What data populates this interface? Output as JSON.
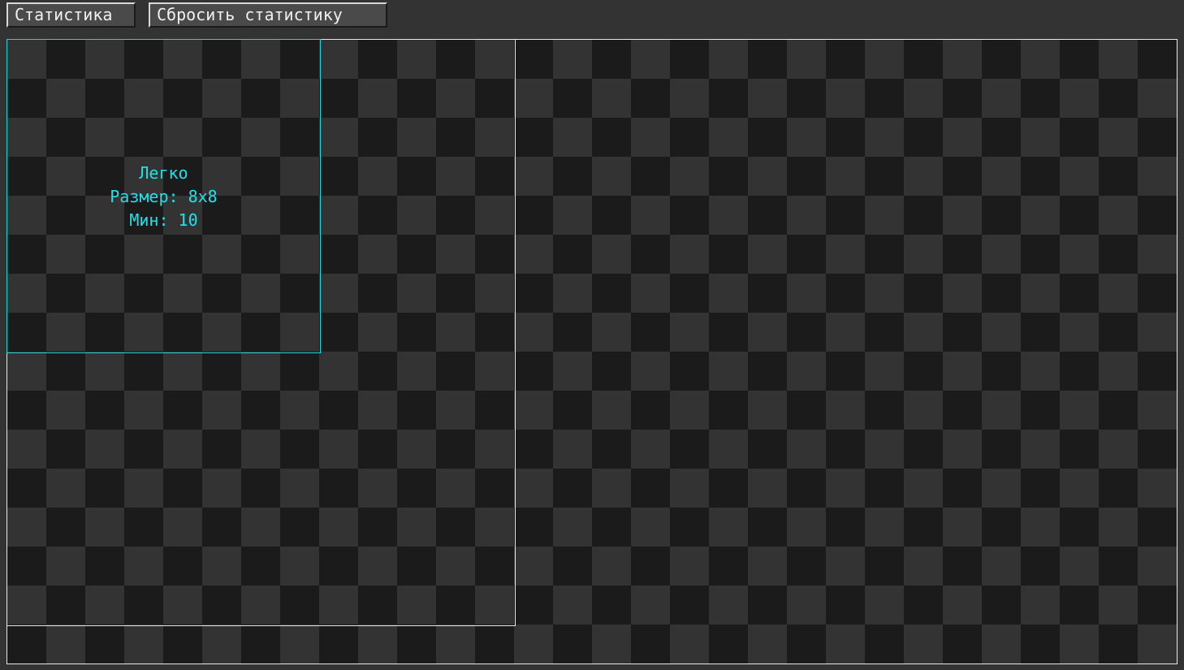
{
  "toolbar": {
    "stats_label": "Статистика",
    "reset_label": "Сбросить статистику"
  },
  "difficulty_selected": {
    "name": "Легко",
    "size_text": "Размер: 8x8",
    "mines_text": "Мин: 10"
  },
  "colors": {
    "background": "#333333",
    "tile_dark": "#1b1b1b",
    "tile_light": "#333333",
    "highlight": "#22e0e6",
    "frame": "#e8e8e8"
  }
}
